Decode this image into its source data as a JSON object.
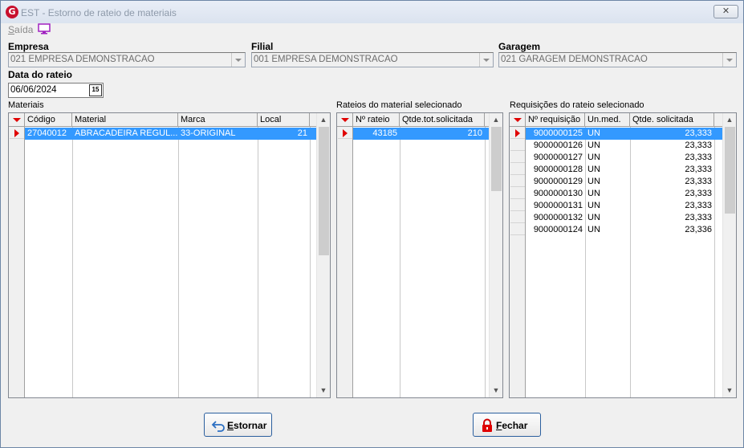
{
  "window": {
    "logo_letter": "G",
    "title": "EST - Estorno de rateio de materiais",
    "close_symbol": "✕"
  },
  "menu": {
    "saida_first": "S",
    "saida_rest": "aída"
  },
  "filters": {
    "empresa_label": "Empresa",
    "empresa_value": "021 EMPRESA DEMONSTRACAO",
    "filial_label": "Filial",
    "filial_value": "001 EMPRESA DEMONSTRACAO",
    "garagem_label": "Garagem",
    "garagem_value": "021 GARAGEM DEMONSTRACAO",
    "data_label": "Data do rateio",
    "data_value": "06/06/2024",
    "calendar_text": "15"
  },
  "materiais": {
    "label": "Materiais",
    "headers": [
      "Código",
      "Material",
      "Marca",
      "Local"
    ],
    "rows": [
      {
        "codigo": "27040012",
        "material": "ABRACADEIRA REGUL...",
        "marca": "33-ORIGINAL",
        "local": "21"
      }
    ]
  },
  "rateios": {
    "label": "Rateios do material selecionado",
    "headers": [
      "Nº rateio",
      "Qtde.tot.solicitada"
    ],
    "rows": [
      {
        "numero": "43185",
        "qtde": "210"
      }
    ]
  },
  "requisicoes": {
    "label": "Requisições do rateio selecionado",
    "headers": [
      "Nº requisição",
      "Un.med.",
      "Qtde. solicitada"
    ],
    "rows": [
      {
        "numero": "9000000125",
        "un": "UN",
        "qtde": "23,333"
      },
      {
        "numero": "9000000126",
        "un": "UN",
        "qtde": "23,333"
      },
      {
        "numero": "9000000127",
        "un": "UN",
        "qtde": "23,333"
      },
      {
        "numero": "9000000128",
        "un": "UN",
        "qtde": "23,333"
      },
      {
        "numero": "9000000129",
        "un": "UN",
        "qtde": "23,333"
      },
      {
        "numero": "9000000130",
        "un": "UN",
        "qtde": "23,333"
      },
      {
        "numero": "9000000131",
        "un": "UN",
        "qtde": "23,333"
      },
      {
        "numero": "9000000132",
        "un": "UN",
        "qtde": "23,333"
      },
      {
        "numero": "9000000124",
        "un": "UN",
        "qtde": "23,336"
      }
    ]
  },
  "buttons": {
    "estornar_first": "E",
    "estornar_rest": "stornar",
    "fechar_first": "F",
    "fechar_rest": "echar"
  },
  "colors": {
    "selection": "#3399ff",
    "indicator": "#e00000",
    "button_border": "#2b5f9e"
  }
}
